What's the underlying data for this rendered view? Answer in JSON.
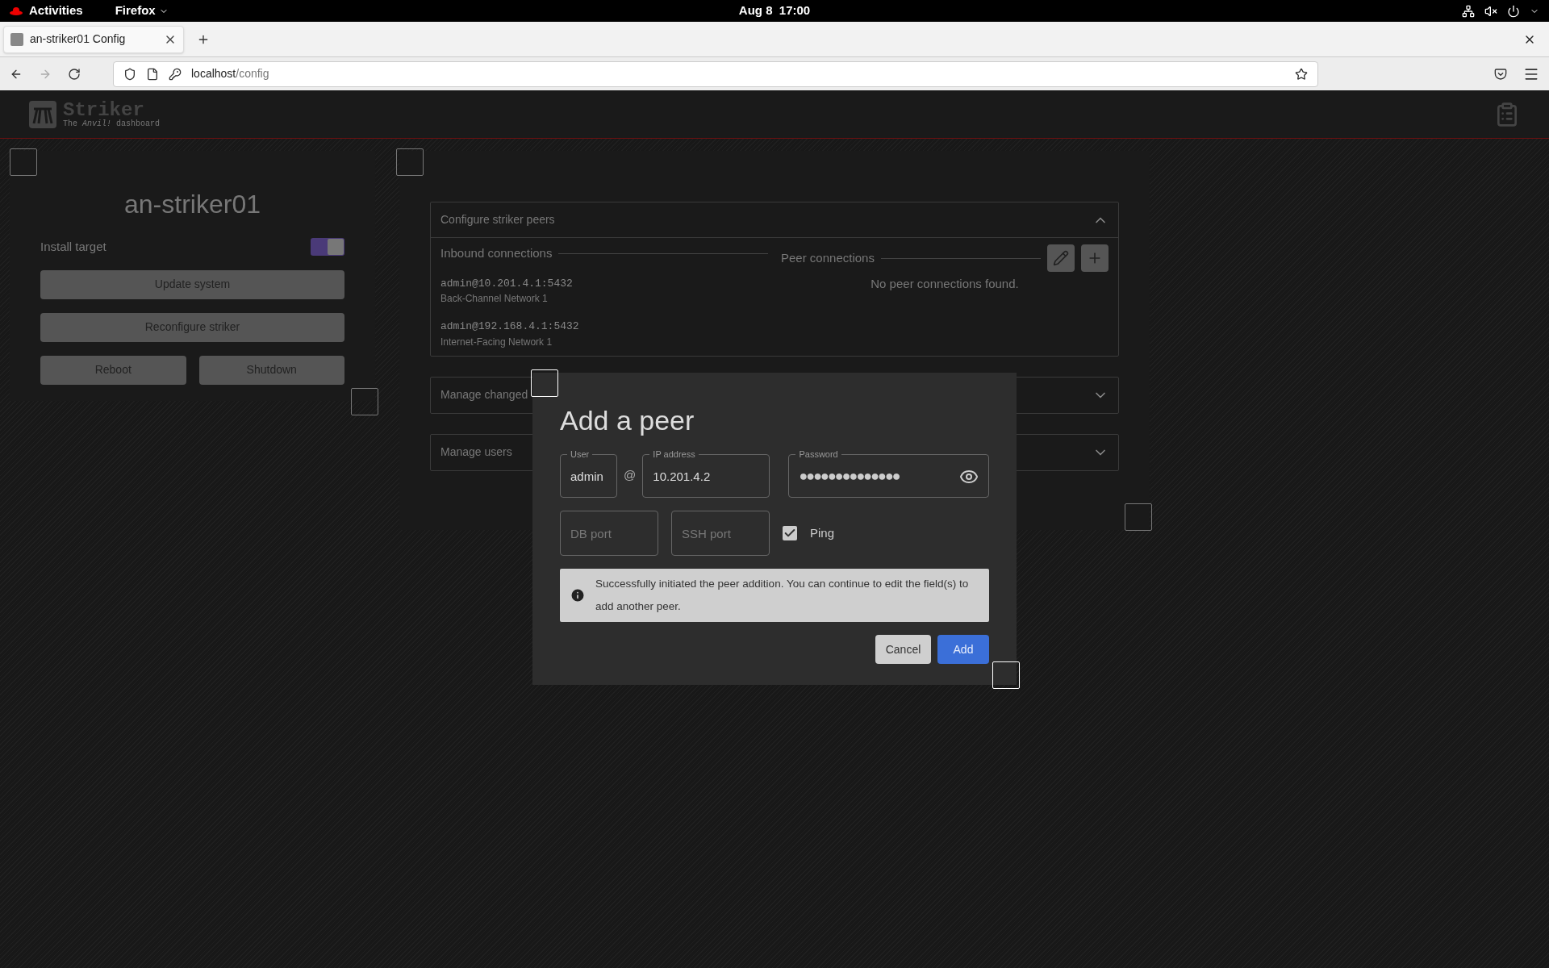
{
  "top_bar": {
    "activities": "Activities",
    "app": "Firefox",
    "clock": "Aug 8  17:00"
  },
  "browser": {
    "tab_title": "an-striker01 Config",
    "url_host": "localhost",
    "url_path": "/config"
  },
  "header": {
    "logo_title": "Striker",
    "logo_subtitle": "The *Anvil!* dashboard"
  },
  "host_panel": {
    "title": "an-striker01",
    "install_target": {
      "label": "Install target",
      "on": true
    },
    "buttons": [
      "Update system",
      "Reconfigure striker"
    ],
    "row_buttons": [
      "Reboot",
      "Shutdown"
    ]
  },
  "sections": [
    {
      "title": "Configure striker peers",
      "expanded": true
    },
    {
      "title": "Manage changed",
      "expanded": false
    },
    {
      "title": "Manage users",
      "expanded": false
    }
  ],
  "peers": {
    "inbound_heading": "Inbound connections",
    "inbound": [
      {
        "address": "admin@10.201.4.1:5432",
        "network": "Back-Channel Network 1"
      },
      {
        "address": "admin@192.168.4.1:5432",
        "network": "Internet-Facing Network 1"
      }
    ],
    "peer_heading": "Peer connections",
    "empty": "No peer connections found."
  },
  "dialog": {
    "title": "Add a peer",
    "user": {
      "label": "User",
      "value": "admin"
    },
    "at": "@",
    "ip": {
      "label": "IP address",
      "value": "10.201.4.2"
    },
    "password": {
      "label": "Password",
      "value": "●●●●●●●●●●●●●●"
    },
    "db_port": {
      "placeholder": "DB port"
    },
    "ssh_port": {
      "placeholder": "SSH port"
    },
    "ping": {
      "label": "Ping",
      "checked": true
    },
    "message": "Successfully initiated the peer addition. You can continue to edit the field(s) to add another peer.",
    "cancel": "Cancel",
    "add": "Add"
  }
}
